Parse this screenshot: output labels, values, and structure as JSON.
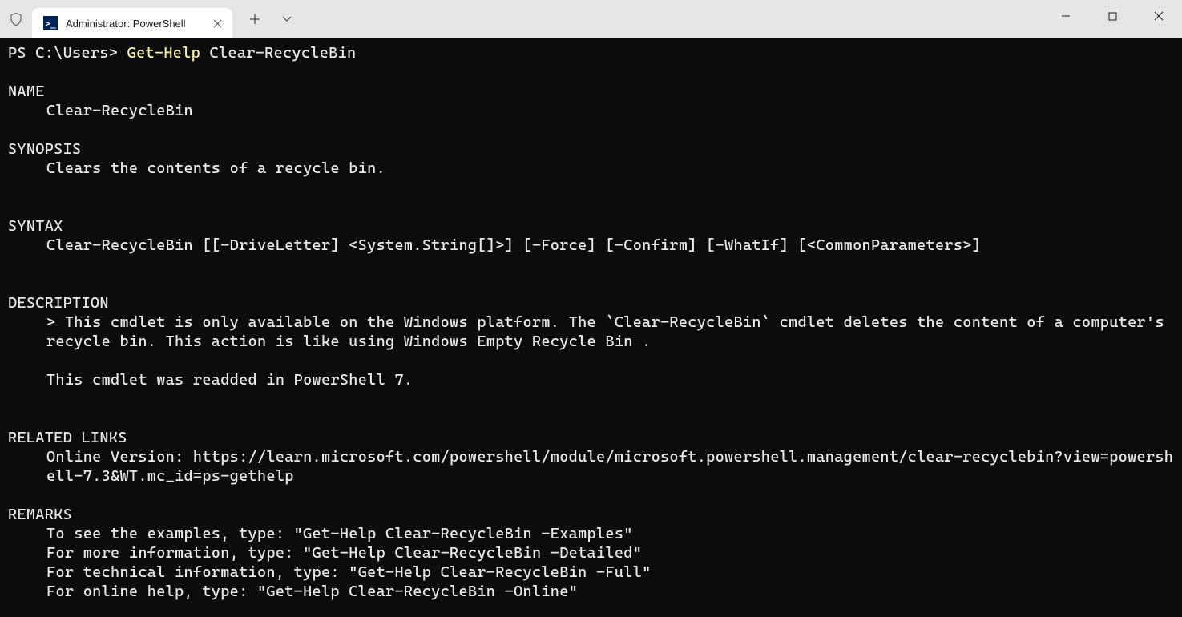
{
  "titlebar": {
    "tab_title": "Administrator: PowerShell",
    "tab_icon_text": ">_"
  },
  "prompt": {
    "prefix": "PS C:\\Users> ",
    "command": "Get-Help",
    "argument": " Clear-RecycleBin"
  },
  "sections": {
    "name_header": "NAME",
    "name_value": "Clear-RecycleBin",
    "synopsis_header": "SYNOPSIS",
    "synopsis_value": "Clears the contents of a recycle bin.",
    "syntax_header": "SYNTAX",
    "syntax_value": "Clear-RecycleBin [[-DriveLetter] <System.String[]>] [-Force] [-Confirm] [-WhatIf] [<CommonParameters>]",
    "description_header": "DESCRIPTION",
    "description_line1": "> This cmdlet is only available on the Windows platform. The `Clear-RecycleBin` cmdlet deletes the content of a computer's recycle bin. This action is like using Windows Empty Recycle Bin .",
    "description_line2": "This cmdlet was readded in PowerShell 7.",
    "related_header": "RELATED LINKS",
    "related_value": "Online Version: https://learn.microsoft.com/powershell/module/microsoft.powershell.management/clear-recyclebin?view=powershell-7.3&WT.mc_id=ps-gethelp",
    "remarks_header": "REMARKS",
    "remarks_l1": "To see the examples, type: \"Get-Help Clear-RecycleBin -Examples\"",
    "remarks_l2": "For more information, type: \"Get-Help Clear-RecycleBin -Detailed\"",
    "remarks_l3": "For technical information, type: \"Get-Help Clear-RecycleBin -Full\"",
    "remarks_l4": "For online help, type: \"Get-Help Clear-RecycleBin -Online\""
  }
}
